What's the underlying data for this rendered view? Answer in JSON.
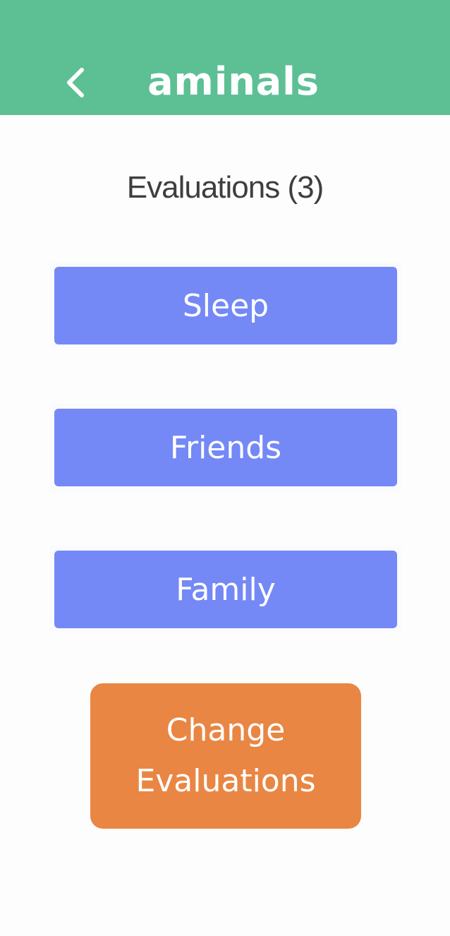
{
  "header": {
    "title": "aminals",
    "back_icon": "chevron-left-icon",
    "background": "#5dc094"
  },
  "main": {
    "section_title": "Evaluations (3)",
    "evaluations": [
      {
        "label": "Sleep"
      },
      {
        "label": "Friends"
      },
      {
        "label": "Family"
      }
    ],
    "change_button": {
      "line1": "Change",
      "line2": "Evaluations"
    }
  },
  "colors": {
    "evaluation_button": "#7489f6",
    "change_button": "#e98644",
    "text_dark": "#3e3e3e"
  }
}
